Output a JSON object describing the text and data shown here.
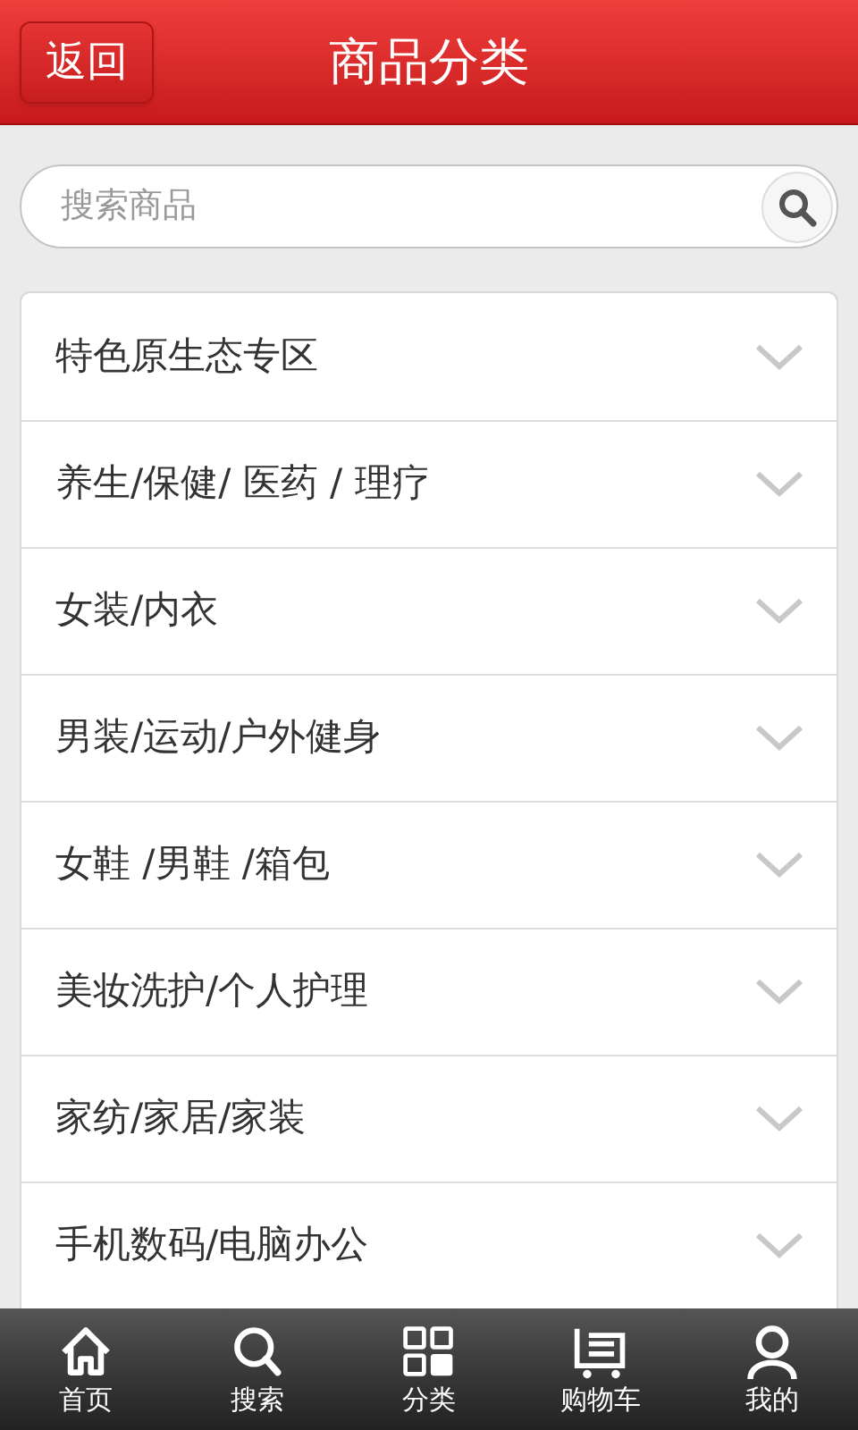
{
  "header": {
    "back_button": "返回",
    "title": "商品分类"
  },
  "search": {
    "placeholder": "搜索商品"
  },
  "categories": [
    {
      "label": "特色原生态专区"
    },
    {
      "label": "养生/保健/ 医药 / 理疗"
    },
    {
      "label": "女装/内衣"
    },
    {
      "label": "男装/运动/户外健身"
    },
    {
      "label": "女鞋 /男鞋 /箱包"
    },
    {
      "label": "美妆洗护/个人护理"
    },
    {
      "label": "家纺/家居/家装"
    },
    {
      "label": "手机数码/电脑办公"
    }
  ],
  "bottom_nav": [
    {
      "label": "首页",
      "kind": "home"
    },
    {
      "label": "搜索",
      "kind": "search"
    },
    {
      "label": "分类",
      "kind": "category"
    },
    {
      "label": "购物车",
      "kind": "cart"
    },
    {
      "label": "我的",
      "kind": "user"
    }
  ]
}
